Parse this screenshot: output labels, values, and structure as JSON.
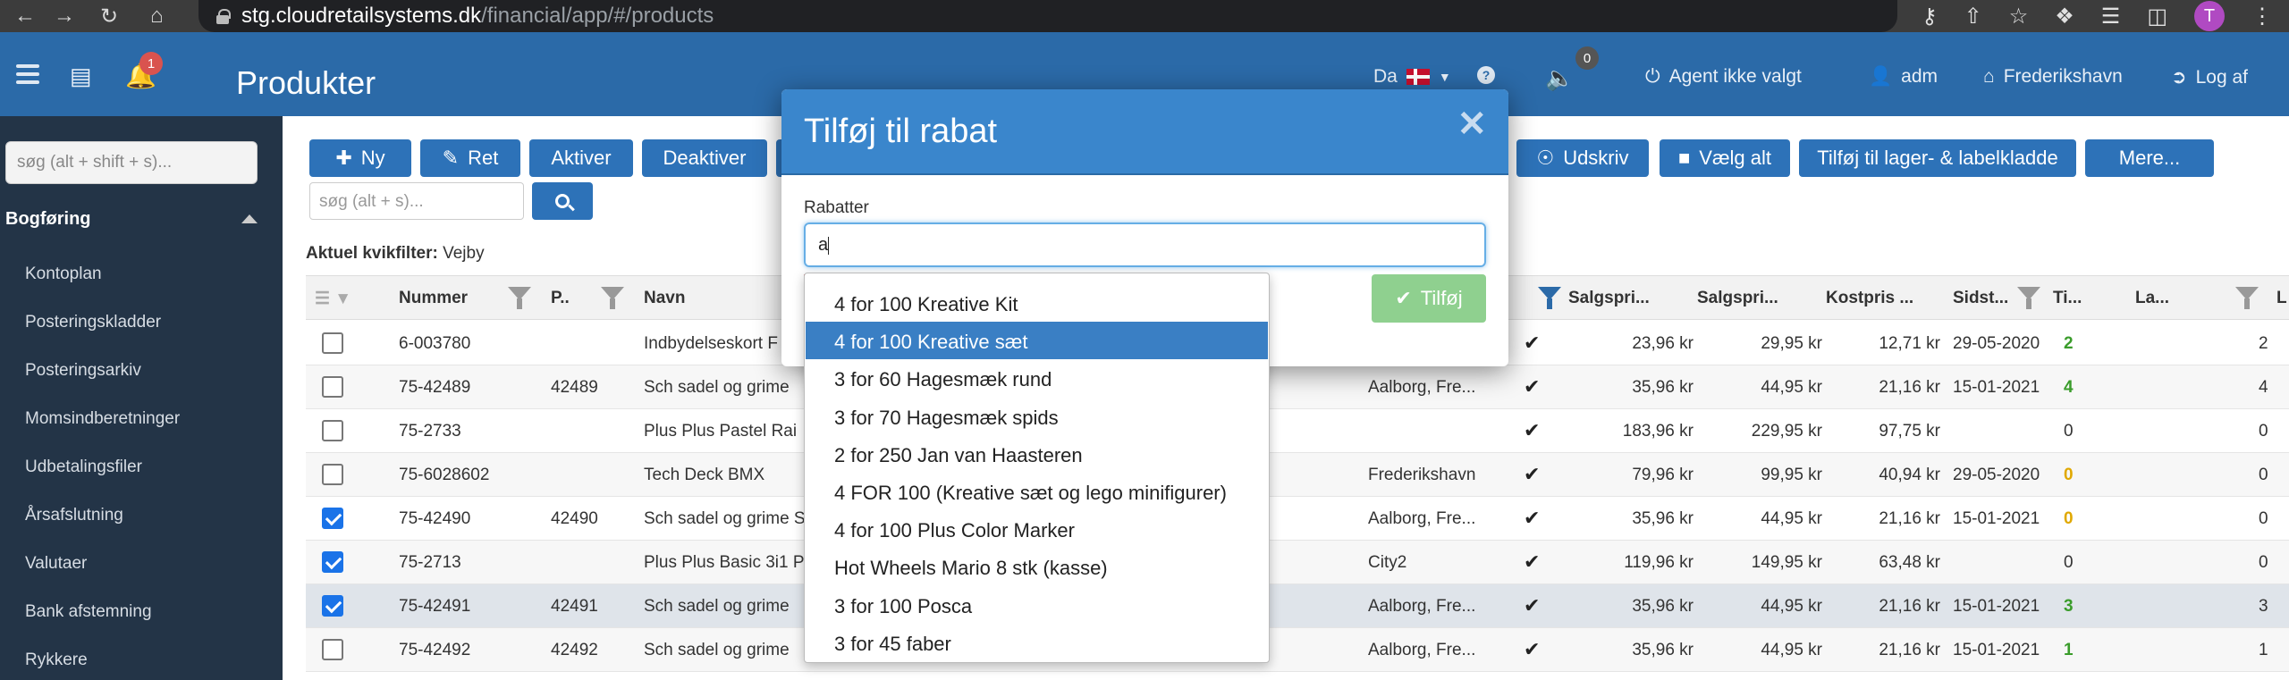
{
  "browser": {
    "url_host": "stg.cloudretailsystems.dk",
    "url_path": "/financial/app/#/products",
    "profile_initial": "T"
  },
  "header": {
    "title": "Produkter",
    "notification_count": "1",
    "language": "Da",
    "sound_count": "0",
    "agent": "Agent ikke valgt",
    "user": "adm",
    "store": "Frederikshavn",
    "logout": "Log af"
  },
  "sidebar": {
    "search_placeholder": "søg (alt + shift + s)...",
    "group": "Bogføring",
    "items": [
      "Kontoplan",
      "Posteringskladder",
      "Posteringsarkiv",
      "Momsindberetninger",
      "Udbetalingsfiler",
      "Årsafslutning",
      "Valutaer",
      "Bank afstemning",
      "Rykkere"
    ]
  },
  "toolbar": {
    "new": "Ny",
    "edit": "Ret",
    "activate": "Aktiver",
    "deactivate": "Deaktiver",
    "print": "Udskriv",
    "select_all": "Vælg alt",
    "add_to_stock": "Tilføj til lager- & labelkladde",
    "more": "Mere...",
    "search_placeholder": "søg (alt + s)..."
  },
  "quickfilter": {
    "label": "Aktuel kvikfilter:",
    "value": "Vejby"
  },
  "table": {
    "headers": {
      "number": "Nummer",
      "p": "P..",
      "name": "Navn",
      "sale1": "Salgspri...",
      "sale2": "Salgspri...",
      "cost": "Kostpris ...",
      "last": "Sidst...",
      "ti": "Ti...",
      "la": "La...",
      "l": "L"
    },
    "rows": [
      {
        "checked": false,
        "number": "6-003780",
        "p": "",
        "name": "Indbydelseskort F",
        "store": "",
        "s1": "23,96 kr",
        "s2": "29,95 kr",
        "cost": "12,71 kr",
        "date": "29-05-2020",
        "ti": "2",
        "ti_color": "green",
        "la": "2"
      },
      {
        "checked": false,
        "number": "75-42489",
        "p": "42489",
        "name": "Sch sadel og grime",
        "store": "Aalborg, Fre...",
        "s1": "35,96 kr",
        "s2": "44,95 kr",
        "cost": "21,16 kr",
        "date": "15-01-2021",
        "ti": "4",
        "ti_color": "green",
        "la": "4"
      },
      {
        "checked": false,
        "number": "75-2733",
        "p": "",
        "name": "Plus Plus Pastel Rai",
        "store": "",
        "s1": "183,96 kr",
        "s2": "229,95 kr",
        "cost": "97,75 kr",
        "date": "",
        "ti": "0",
        "ti_color": "none",
        "la": "0"
      },
      {
        "checked": false,
        "number": "75-6028602",
        "p": "",
        "name": "Tech Deck BMX",
        "store": "Frederikshavn",
        "s1": "79,96 kr",
        "s2": "99,95 kr",
        "cost": "40,94 kr",
        "date": "29-05-2020",
        "ti": "0",
        "ti_color": "amber",
        "la": "0"
      },
      {
        "checked": true,
        "number": "75-42490",
        "p": "42490",
        "name": "Sch sadel og grime S",
        "store": "Aalborg, Fre...",
        "s1": "35,96 kr",
        "s2": "44,95 kr",
        "cost": "21,16 kr",
        "date": "15-01-2021",
        "ti": "0",
        "ti_color": "amber",
        "la": "0"
      },
      {
        "checked": true,
        "number": "75-2713",
        "p": "",
        "name": "Plus Plus Basic 3i1 P",
        "store": "City2",
        "s1": "119,96 kr",
        "s2": "149,95 kr",
        "cost": "63,48 kr",
        "date": "",
        "ti": "0",
        "ti_color": "none",
        "la": "0"
      },
      {
        "checked": true,
        "number": "75-42491",
        "p": "42491",
        "name": "Sch sadel og grime",
        "store": "Aalborg, Fre...",
        "s1": "35,96 kr",
        "s2": "44,95 kr",
        "cost": "21,16 kr",
        "date": "15-01-2021",
        "ti": "3",
        "ti_color": "green",
        "la": "3"
      },
      {
        "checked": false,
        "number": "75-42492",
        "p": "42492",
        "name": "Sch sadel og grime",
        "store": "Aalborg, Fre...",
        "s1": "35,96 kr",
        "s2": "44,95 kr",
        "cost": "21,16 kr",
        "date": "15-01-2021",
        "ti": "1",
        "ti_color": "green",
        "la": "1"
      }
    ]
  },
  "modal": {
    "title": "Tilføj til rabat",
    "field_label": "Rabatter",
    "field_value": "a",
    "add_button": "Tilføj",
    "options": [
      "4 for 100 Kreative Kit",
      "4 for 100 Kreative sæt",
      "3 for 60 Hagesmæk rund",
      "3 for 70 Hagesmæk spids",
      "2 for 250 Jan van Haasteren",
      "4 FOR 100 (Kreative sæt og lego minifigurer)",
      "4 for 100 Plus Color Marker",
      "Hot Wheels Mario 8 stk (kasse)",
      "3 for 100 Posca",
      "3 for 45 faber"
    ],
    "active_option_index": 1
  },
  "colors": {
    "header_blue": "#2b6aa8",
    "button_blue": "#2d72b8",
    "sidebar_dark": "#233447",
    "modal_head": "#3a86cc",
    "success_light": "#8fd08f"
  }
}
